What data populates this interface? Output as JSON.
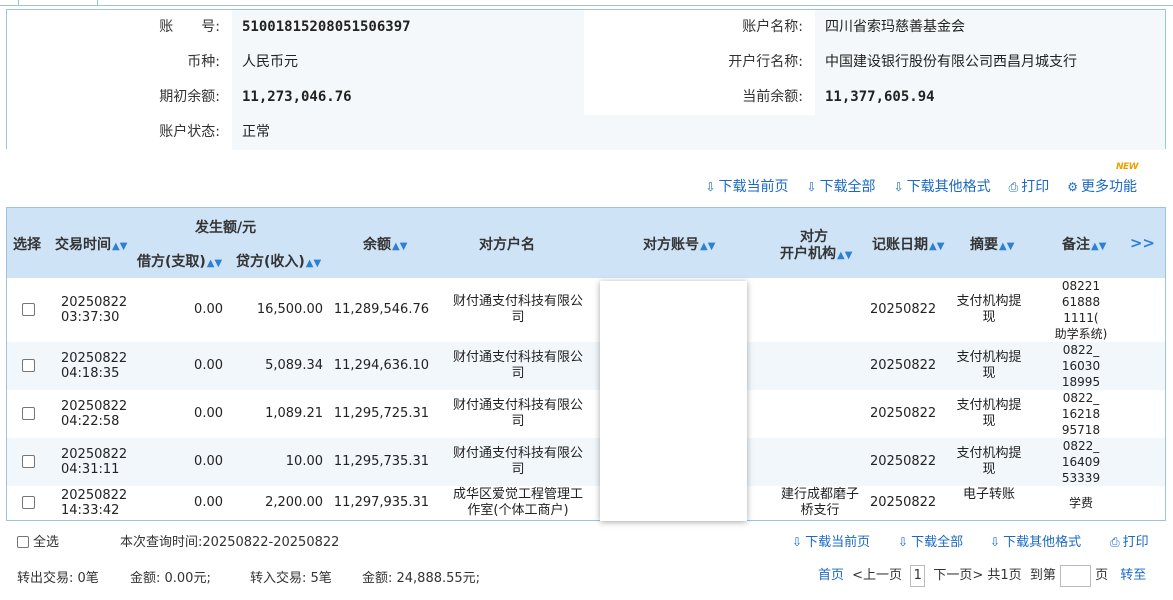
{
  "account_info": {
    "account_no_label": "账　　号:",
    "account_no": "51001815208051506397",
    "account_name_label": "账户名称:",
    "account_name": "四川省索玛慈善基金会",
    "currency_label": "币种:",
    "currency": "人民币元",
    "bank_label": "开户行名称:",
    "bank": "中国建设银行股份有限公司西昌月城支行",
    "opening_balance_label": "期初余额:",
    "opening_balance": "11,273,046.76",
    "current_balance_label": "当前余额:",
    "current_balance": "11,377,605.94",
    "status_label": "账户状态:",
    "status": "正常"
  },
  "toolbar": {
    "download_page": "下载当前页",
    "download_all": "下载全部",
    "download_other": "下载其他格式",
    "print": "打印",
    "more": "更多功能",
    "new_badge": "NEW"
  },
  "table": {
    "headers": {
      "select": "选择",
      "time": "交易时间",
      "amount_group": "发生额/元",
      "debit": "借方(支取)",
      "credit": "贷方(收入)",
      "balance": "余额",
      "counterparty_name": "对方户名",
      "counterparty_account": "对方账号",
      "counterparty_bank_1": "对方",
      "counterparty_bank_2": "开户机构",
      "post_date": "记账日期",
      "summary": "摘要",
      "remark": "备注"
    },
    "rows": [
      {
        "date": "20250822",
        "time": "03:37:30",
        "debit": "0.00",
        "credit": "16,500.00",
        "balance": "11,289,546.76",
        "name1": "财付通支付科技有限公",
        "name2": "司",
        "bank1": "",
        "bank2": "",
        "post_date": "20250822",
        "summary1": "支付机构提",
        "summary2": "现",
        "remark": [
          "08221",
          "61888",
          "1111(",
          "助学系统)"
        ]
      },
      {
        "date": "20250822",
        "time": "04:18:35",
        "debit": "0.00",
        "credit": "5,089.34",
        "balance": "11,294,636.10",
        "name1": "财付通支付科技有限公",
        "name2": "司",
        "bank1": "",
        "bank2": "",
        "post_date": "20250822",
        "summary1": "支付机构提",
        "summary2": "现",
        "remark": [
          "0822_",
          "16030",
          "18995"
        ]
      },
      {
        "date": "20250822",
        "time": "04:22:58",
        "debit": "0.00",
        "credit": "1,089.21",
        "balance": "11,295,725.31",
        "name1": "财付通支付科技有限公",
        "name2": "司",
        "bank1": "",
        "bank2": "",
        "post_date": "20250822",
        "summary1": "支付机构提",
        "summary2": "现",
        "remark": [
          "0822_",
          "16218",
          "95718"
        ]
      },
      {
        "date": "20250822",
        "time": "04:31:11",
        "debit": "0.00",
        "credit": "10.00",
        "balance": "11,295,735.31",
        "name1": "财付通支付科技有限公",
        "name2": "司",
        "bank1": "",
        "bank2": "",
        "post_date": "20250822",
        "summary1": "支付机构提",
        "summary2": "现",
        "remark": [
          "0822_",
          "16409",
          "53339"
        ]
      },
      {
        "date": "20250822",
        "time": "14:33:42",
        "debit": "0.00",
        "credit": "2,200.00",
        "balance": "11,297,935.31",
        "name1": "成华区爱觉工程管理工",
        "name2": "作室(个体工商户)",
        "bank1": "建行成都磨子",
        "bank2": "桥支行",
        "post_date": "20250822",
        "summary1": "电子转账",
        "summary2": "",
        "remark": [
          "学费"
        ]
      }
    ]
  },
  "footer": {
    "select_all": "全选",
    "query_time": "本次查询时间:20250822-20250822",
    "download_page": "下载当前页",
    "download_all": "下载全部",
    "download_other": "下载其他格式",
    "print": "打印",
    "out_count": "转出交易: 0笔",
    "out_amount": "金额: 0.00元;",
    "in_count": "转入交易: 5笔",
    "in_amount": "金额: 24,888.55元;",
    "first_page": "首页",
    "prev_page": "<上一页",
    "current_page": "1",
    "next_page": "下一页>",
    "total_pages": "共1页",
    "goto_label": "到第",
    "page_unit": "页",
    "goto_button": "转至"
  }
}
